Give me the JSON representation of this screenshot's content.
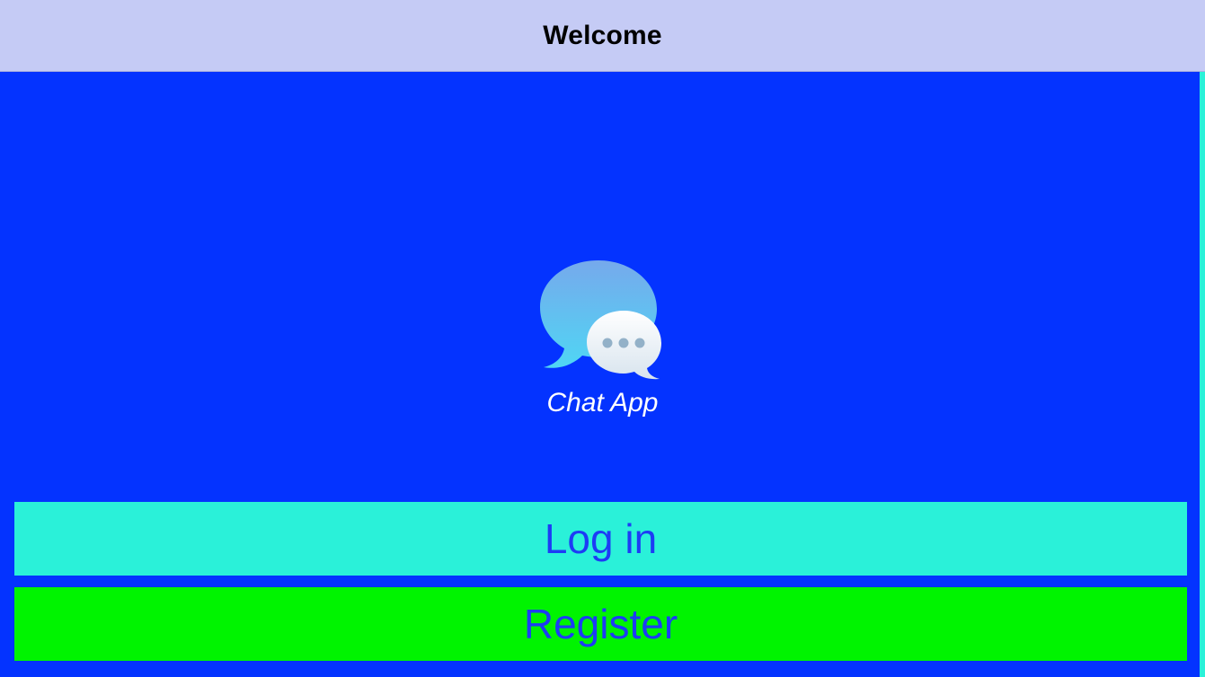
{
  "nav": {
    "title": "Welcome"
  },
  "logo": {
    "icon": "chat-bubbles-icon",
    "app_name": "Chat App"
  },
  "buttons": {
    "login_label": "Log in",
    "register_label": "Register"
  },
  "colors": {
    "background": "#0433ff",
    "nav_bar": "#c5cbf5",
    "login_button": "#2af1d9",
    "register_button": "#00f400",
    "button_text": "#1d3cf5",
    "app_name_text": "#ffffff"
  }
}
